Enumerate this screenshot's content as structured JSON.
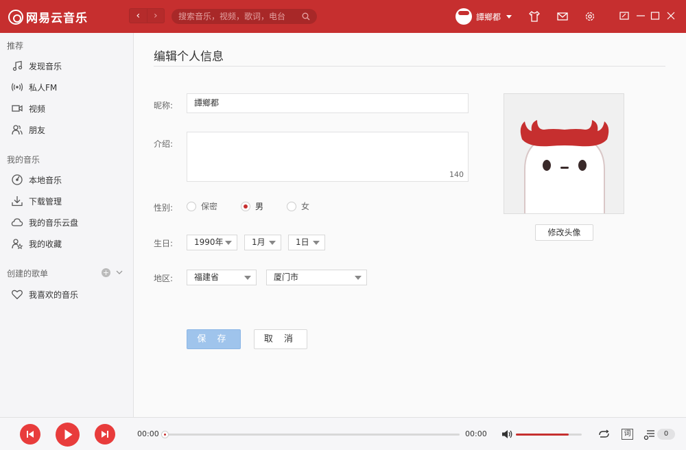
{
  "app": {
    "name": "网易云音乐"
  },
  "search": {
    "placeholder": "搜索音乐，视频，歌词，电台"
  },
  "user": {
    "name": "譚鄉都"
  },
  "sidebar": {
    "section_recommend": "推荐",
    "recommend_items": [
      {
        "label": "发现音乐",
        "icon": "music-note-icon"
      },
      {
        "label": "私人FM",
        "icon": "radio-icon"
      },
      {
        "label": "视频",
        "icon": "video-icon"
      },
      {
        "label": "朋友",
        "icon": "friends-icon"
      }
    ],
    "section_my_music": "我的音乐",
    "my_music_items": [
      {
        "label": "本地音乐",
        "icon": "local-music-icon"
      },
      {
        "label": "下载管理",
        "icon": "download-icon"
      },
      {
        "label": "我的音乐云盘",
        "icon": "cloud-icon"
      },
      {
        "label": "我的收藏",
        "icon": "collection-icon"
      }
    ],
    "section_created": "创建的歌单",
    "created_items": [
      {
        "label": "我喜欢的音乐",
        "icon": "heart-icon"
      }
    ]
  },
  "form": {
    "title": "编辑个人信息",
    "nickname_label": "昵称:",
    "nickname_value": "譚鄉都",
    "intro_label": "介绍:",
    "intro_value": "",
    "intro_counter": "140",
    "gender_label": "性别:",
    "gender_options": [
      "保密",
      "男",
      "女"
    ],
    "gender_selected": "男",
    "birthday_label": "生日:",
    "birthday_year": "1990年",
    "birthday_month": "1月",
    "birthday_day": "1日",
    "region_label": "地区:",
    "region_province": "福建省",
    "region_city": "厦门市",
    "save_label": "保 存",
    "cancel_label": "取 消",
    "change_avatar_label": "修改头像"
  },
  "player": {
    "current_time": "00:00",
    "total_time": "00:00",
    "progress": 0,
    "volume": 0.8,
    "lyric_label": "词",
    "playlist_count": "0"
  },
  "colors": {
    "brand": "#c62f2f",
    "player_red": "#e83c3c",
    "save_disabled": "#9fc4ec"
  }
}
